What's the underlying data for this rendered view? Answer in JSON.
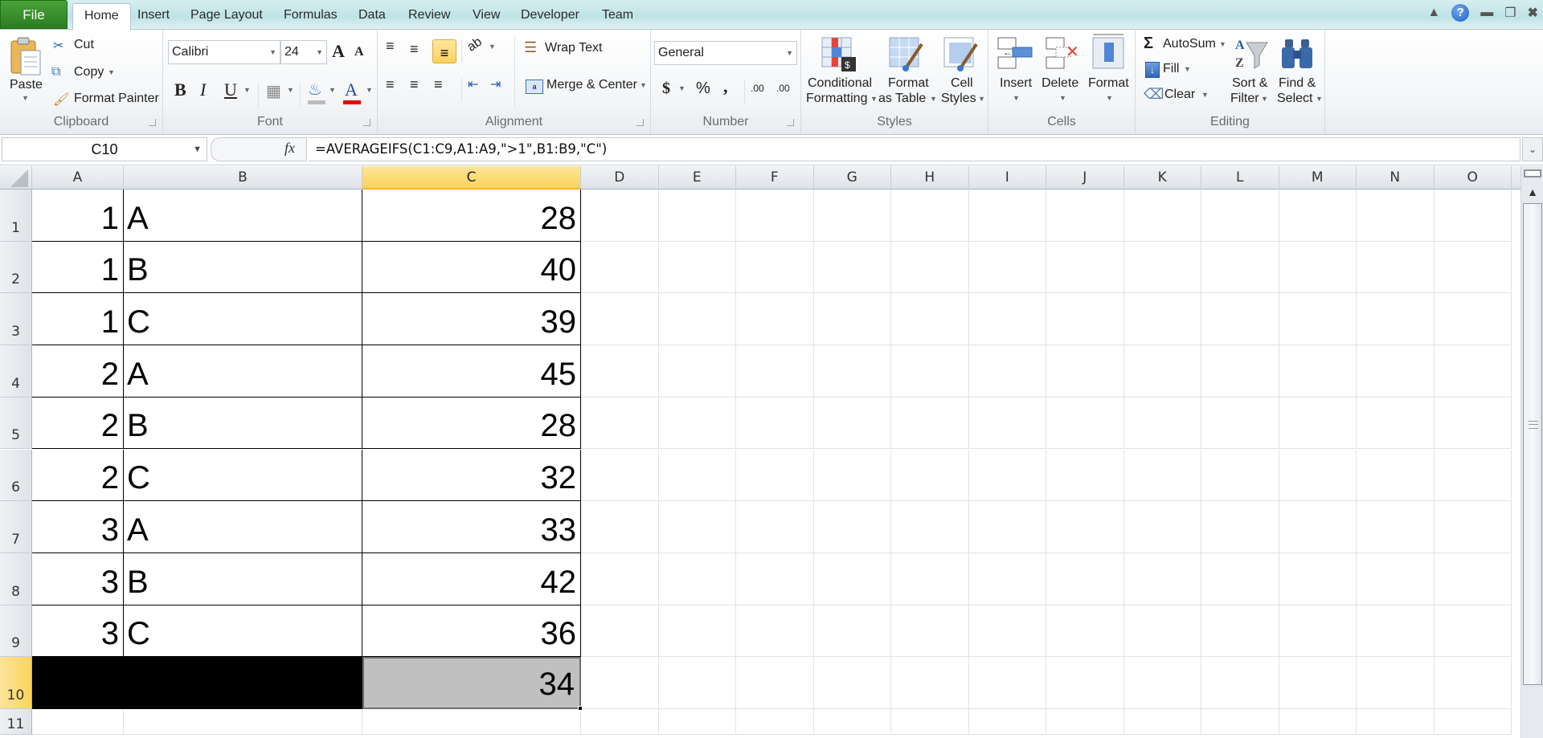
{
  "tabs": [
    {
      "label": "File"
    },
    {
      "label": "Home"
    },
    {
      "label": "Insert"
    },
    {
      "label": "Page Layout"
    },
    {
      "label": "Formulas"
    },
    {
      "label": "Data"
    },
    {
      "label": "Review"
    },
    {
      "label": "View"
    },
    {
      "label": "Developer"
    },
    {
      "label": "Team"
    }
  ],
  "window_icons": {
    "help": "?"
  },
  "ribbon": {
    "clipboard": {
      "label": "Clipboard",
      "paste": "Paste",
      "cut": "Cut",
      "copy": "Copy",
      "format_painter": "Format Painter"
    },
    "font": {
      "label": "Font",
      "font_name": "Calibri",
      "font_size": "24",
      "bold": "B",
      "italic": "I",
      "underline": "U",
      "font_color_glyph": "A",
      "grow_glyph": "A",
      "shrink_glyph": "A"
    },
    "alignment": {
      "label": "Alignment",
      "wrap_text": "Wrap Text",
      "merge_center": "Merge & Center"
    },
    "number": {
      "label": "Number",
      "format": "General",
      "currency": "$",
      "percent": "%",
      "comma": ",",
      "inc_decimal": ".00",
      "dec_decimal": ".00"
    },
    "styles": {
      "label": "Styles",
      "conditional_1": "Conditional",
      "conditional_2": "Formatting",
      "format_table_1": "Format",
      "format_table_2": "as Table",
      "cell_styles_1": "Cell",
      "cell_styles_2": "Styles"
    },
    "cells": {
      "label": "Cells",
      "insert": "Insert",
      "delete": "Delete",
      "format": "Format"
    },
    "editing": {
      "label": "Editing",
      "autosum": "AutoSum",
      "fill": "Fill",
      "clear": "Clear",
      "sort_1": "Sort &",
      "sort_2": "Filter",
      "find_1": "Find &",
      "find_2": "Select",
      "sigma": "Σ"
    }
  },
  "formula_bar": {
    "name_box": "C10",
    "fx": "fx",
    "formula": "=AVERAGEIFS(C1:C9,A1:A9,\">1\",B1:B9,\"C\")"
  },
  "columns": [
    "A",
    "B",
    "C",
    "D",
    "E",
    "F",
    "G",
    "H",
    "I",
    "J",
    "K",
    "L",
    "M",
    "N",
    "O"
  ],
  "selected_column": "C",
  "selected_row": 10,
  "rows": [
    {
      "num": "1",
      "a": "1",
      "b": "A",
      "c": "28"
    },
    {
      "num": "2",
      "a": "1",
      "b": "B",
      "c": "40"
    },
    {
      "num": "3",
      "a": "1",
      "b": "C",
      "c": "39"
    },
    {
      "num": "4",
      "a": "2",
      "b": "A",
      "c": "45"
    },
    {
      "num": "5",
      "a": "2",
      "b": "B",
      "c": "28"
    },
    {
      "num": "6",
      "a": "2",
      "b": "C",
      "c": "32"
    },
    {
      "num": "7",
      "a": "3",
      "b": "A",
      "c": "33"
    },
    {
      "num": "8",
      "a": "3",
      "b": "B",
      "c": "42"
    },
    {
      "num": "9",
      "a": "3",
      "b": "C",
      "c": "36"
    },
    {
      "num": "10",
      "a": "",
      "b": "",
      "c": "34"
    },
    {
      "num": "11",
      "a": "",
      "b": "",
      "c": ""
    }
  ],
  "colors": {
    "file_tab": "#2b7d20",
    "selected_header": "#f9d45c",
    "black_fill": "#000000",
    "result_fill": "#c0c0c0"
  }
}
